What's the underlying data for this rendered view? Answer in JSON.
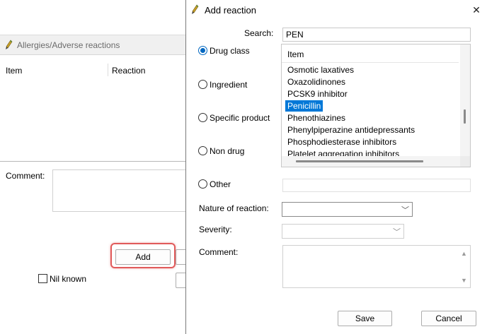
{
  "background_window": {
    "section_title": "Allergies/Adverse reactions",
    "columns": [
      "Item",
      "Reaction"
    ],
    "comment_label": "Comment:",
    "add_button": "Add",
    "nil_known_label": "Nil known",
    "highlight_color": "#e15a5a"
  },
  "dialog": {
    "title": "Add reaction",
    "search": {
      "label": "Search:",
      "value": "PEN"
    },
    "radios": [
      {
        "label": "Drug class",
        "selected": true
      },
      {
        "label": "Ingredient",
        "selected": false
      },
      {
        "label": "Specific product",
        "selected": false
      },
      {
        "label": "Non drug",
        "selected": false
      },
      {
        "label": "Other",
        "selected": false
      }
    ],
    "list": {
      "header": "Item",
      "items": [
        "Osmotic laxatives",
        "Oxazolidinones",
        "PCSK9 inhibitor",
        "Penicillin",
        "Phenothiazines",
        "Phenylpiperazine antidepressants",
        "Phosphodiesterase inhibitors",
        "Platelet aggregation inhibitors"
      ],
      "selected_index": 3
    },
    "nature_label": "Nature of reaction:",
    "nature_value": "",
    "severity_label": "Severity:",
    "severity_value": "",
    "comment_label": "Comment:",
    "save_button": "Save",
    "cancel_button": "Cancel",
    "accent_color": "#0078d7",
    "icons": {
      "close": "close-icon",
      "pen": "pen-icon",
      "chevron": "chevron-down-icon"
    }
  }
}
